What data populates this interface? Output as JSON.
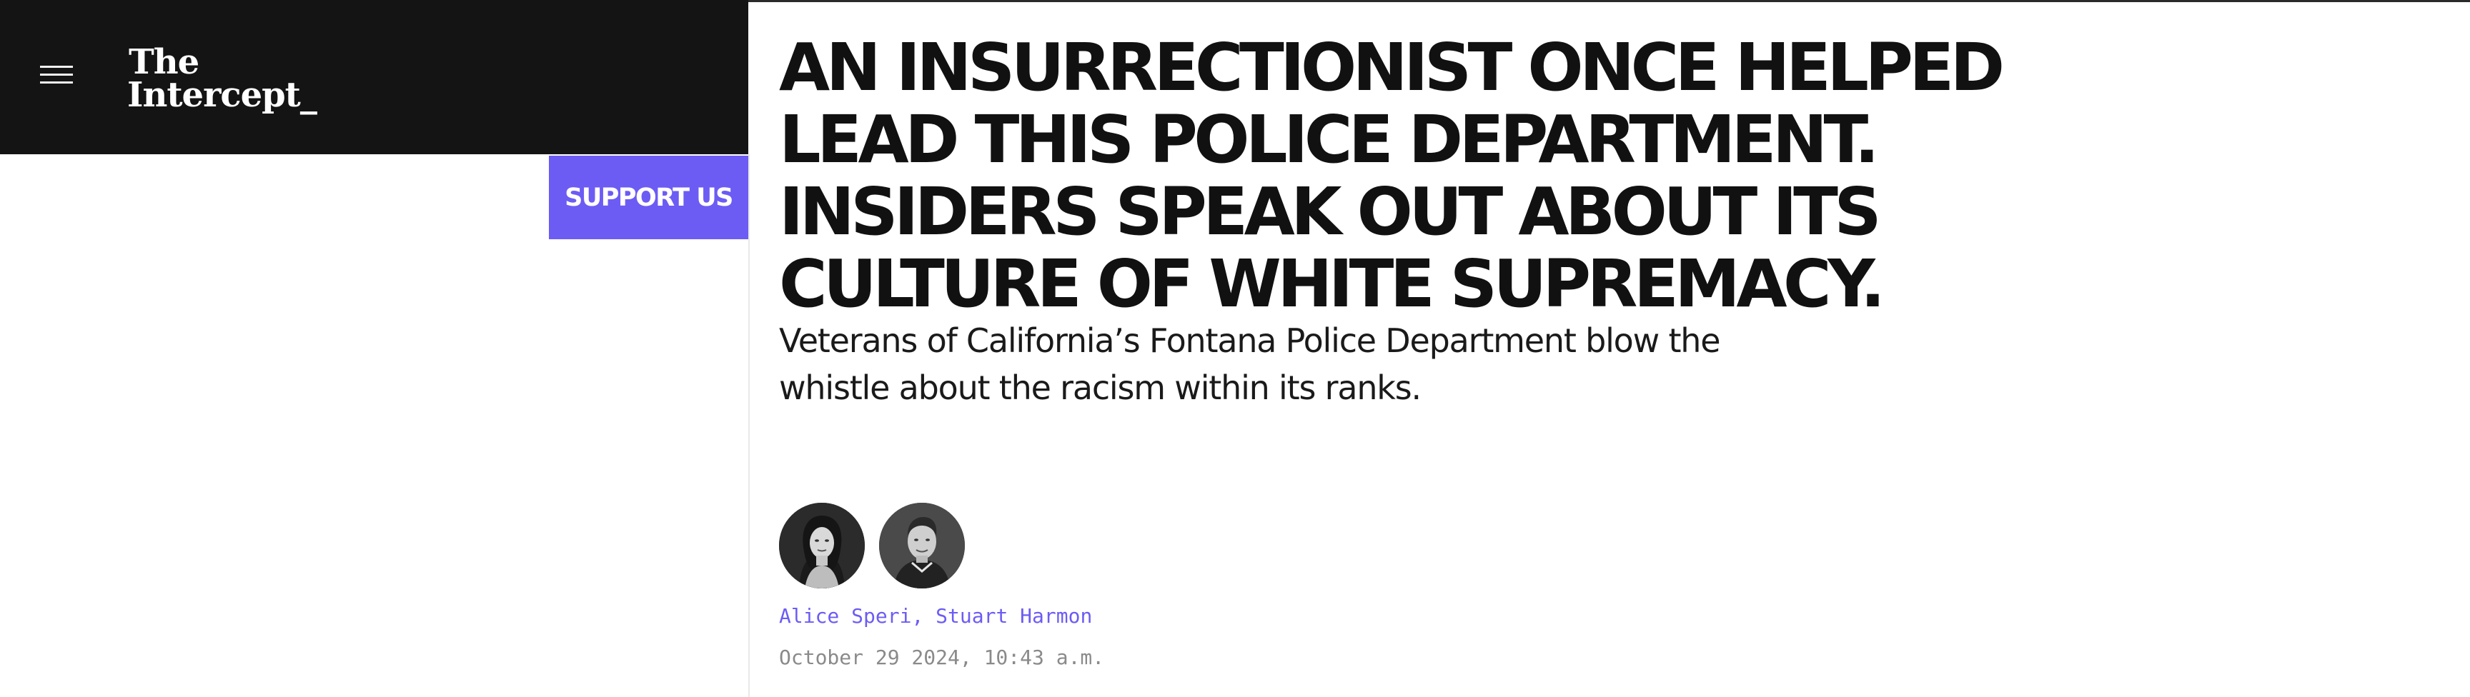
{
  "header": {
    "logo_line1": "The",
    "logo_line2": "Intercept_",
    "menu_icon": "hamburger-menu-icon",
    "background": "#141414"
  },
  "support": {
    "label": "SUPPORT US",
    "color": "#6c5cf4"
  },
  "article": {
    "headline": "AN INSURRECTIONIST ONCE HELPED LEAD THIS POLICE DEPARTMENT. INSIDERS SPEAK OUT ABOUT ITS CULTURE OF WHITE SUPREMACY.",
    "dek": "Veterans of California’s Fontana Police Department blow the whistle about the racism within its ranks.",
    "authors": [
      "Alice Speri",
      "Stuart Harmon"
    ],
    "author_separator": ", ",
    "date": "October 29 2024, 10:43 a.m."
  }
}
